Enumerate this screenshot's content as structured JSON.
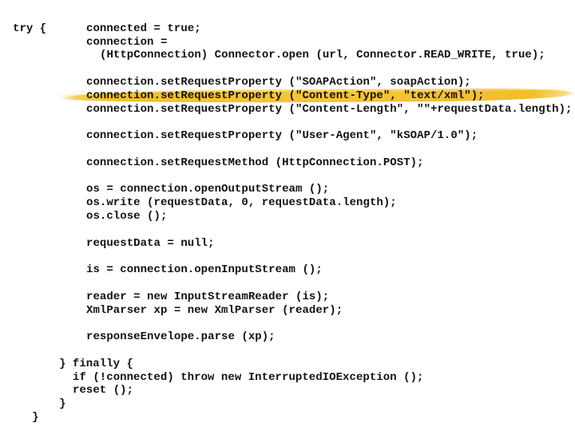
{
  "slide": {
    "highlight_color": "#f2c02e",
    "highlighted_line_index": 5,
    "code_lines": [
      {
        "text": "try {"
      },
      {
        "text": "connected = true;"
      },
      {
        "text": "connection ="
      },
      {
        "text": "(HttpConnection) Connector.open (url, Connector.READ_WRITE, true);"
      },
      {
        "text": "connection.setRequestProperty (\"SOAPAction\", soapAction);"
      },
      {
        "text": "connection.setRequestProperty (\"Content-Type\", \"text/xml\");"
      },
      {
        "text": "connection.setRequestProperty (\"Content-Length\", \"\"+requestData.length);"
      },
      {
        "text": "connection.setRequestProperty (\"User-Agent\", \"kSOAP/1.0\");"
      },
      {
        "text": "connection.setRequestMethod (HttpConnection.POST);"
      },
      {
        "text": "os = connection.openOutputStream ();"
      },
      {
        "text": "os.write (requestData, 0, requestData.length);"
      },
      {
        "text": "os.close ();"
      },
      {
        "text": "requestData = null;"
      },
      {
        "text": "is = connection.openInputStream ();"
      },
      {
        "text": "reader = new InputStreamReader (is);"
      },
      {
        "text": "XmlParser xp = new XmlParser (reader);"
      },
      {
        "text": "responseEnvelope.parse (xp);"
      },
      {
        "text": "} finally {"
      },
      {
        "text": "if (!connected) throw new InterruptedIOException ();"
      },
      {
        "text": "reset ();"
      },
      {
        "text": "}"
      },
      {
        "text": "}"
      }
    ]
  }
}
